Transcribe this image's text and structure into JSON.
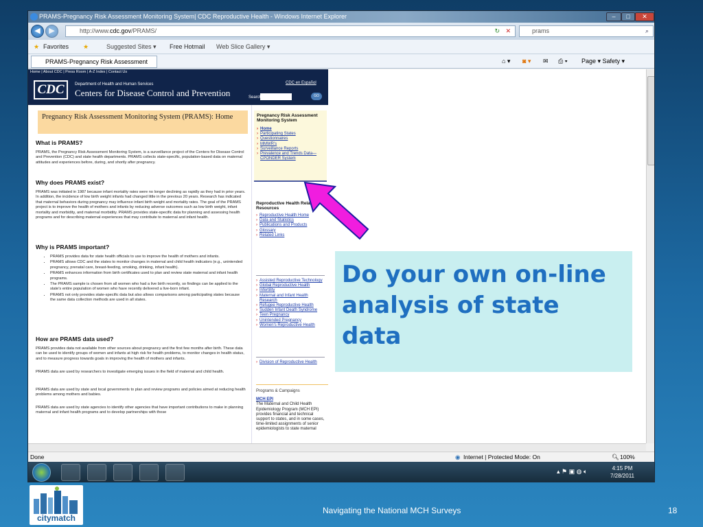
{
  "window": {
    "title": "PRAMS-Pregnancy Risk Assessment Monitoring System| CDC Reproductive Health - Windows Internet Explorer",
    "url_prefix": "http://www.",
    "url_domain": "cdc.gov",
    "url_path": "/PRAMS/",
    "search_value": "prams"
  },
  "favorites_bar": {
    "favorites": "Favorites",
    "suggested": "Suggested Sites ▾",
    "hotmail": "Free Hotmail",
    "webslice": "Web Slice Gallery ▾"
  },
  "tab": {
    "label": "PRAMS-Pregnancy Risk Assessment M...",
    "tools": "Page ▾   Safety ▾"
  },
  "cdc": {
    "toplinks": "Home  |  About CDC  |  Press Room  |  A-Z Index  |  Contact Us",
    "logo": "CDC",
    "dept": "Department of Health and Human Services",
    "name": "Centers for Disease Control and Prevention",
    "espanol": "CDC en Español",
    "search_label": "Search:",
    "go": "GO"
  },
  "content": {
    "page_title": "Pregnancy Risk Assessment Monitoring System (PRAMS): Home",
    "h1": "What is PRAMS?",
    "p1": "PRAMS, the Pregnancy Risk Assessment Monitoring System, is a surveillance project of the Centers for Disease Control and Prevention (CDC) and state health departments. PRAMS collects state-specific, population-based data on maternal attitudes and experiences before, during, and shortly after pregnancy.",
    "h2": "Why does PRAMS exist?",
    "p2": "PRAMS was initiated in 1987 because infant mortality rates were no longer declining as rapidly as they had in prior years. In addition, the incidence of low birth weight infants had changed little in the previous 20 years. Research has indicated that maternal behaviors during pregnancy may influence infant birth weight and mortality rates. The goal of the PRAMS project is to improve the health of mothers and infants by reducing adverse outcomes such as low birth weight, infant mortality and morbidity, and maternal morbidity. PRAMS provides state-specific data for planning and assessing health programs and for describing maternal experiences that may contribute to maternal and infant health.",
    "h3": "Why is PRAMS important?",
    "bullets": [
      "PRAMS provides data for state health officials to use to improve the health of mothers and infants.",
      "PRAMS allows CDC and the states to monitor changes in maternal and child health indicators (e.g., unintended pregnancy, prenatal care, breast-feeding, smoking, drinking, infant health).",
      "PRAMS enhances information from birth certificates used to plan and review state maternal and infant health programs.",
      "The PRAMS sample is chosen from all women who had a live birth recently, so findings can be applied to the state's entire population of women who have recently delivered a live-born infant.",
      "PRAMS not only provides state-specific data but also allows comparisons among participating states because the same data collection methods are used in all states."
    ],
    "h4": "How are PRAMS data used?",
    "p4": "PRAMS provides data not available from other sources about pregnancy and the first few months after birth. These data can be used to identify groups of women and infants at high risk for health problems, to monitor changes in health status, and to measure progress towards goals in improving the health of mothers and infants.",
    "p5": "PRAMS data are used by researchers to investigate emerging issues in the field of maternal and child health.",
    "p6": "PRAMS data are used by state and local governments to plan and review programs and policies aimed at reducing health problems among mothers and babies.",
    "p7": "PRAMS data are used by state agencies to identify other agencies that have important contributions to make in planning maternal and infant health programs and to develop partnerships with those"
  },
  "sidebar": {
    "box_title": "Pregnancy Risk Assessment Monitoring System",
    "links": [
      "Home",
      "Participating States",
      "Questionnaires",
      "MMWR's",
      "Surveillance Reports",
      "Prevalence and Trends Data—CPONDER System"
    ],
    "rr_title": "Reproductive Health Related Resources",
    "rr_links": [
      "Reproductive Health Home",
      "Data and Statistics",
      "Publications and Products",
      "Glossary",
      "Related Links"
    ],
    "rr_links2": [
      "Assisted Reproductive Technology",
      "Global Reproductive Health",
      "Infertility",
      "Maternal and Infant Health Research",
      "Refugee Reproductive Health",
      "Sudden Infant Death Syndrome",
      "Teen Pregnancy",
      "Unintended Pregnancy",
      "Women's Reproductive Health"
    ],
    "rr_links3": [
      "Division of Reproductive Health"
    ],
    "programs_title": "Programs & Campaigns",
    "programs_link": "MCH EPI",
    "programs_text": "The Maternal and Child Health Epidemiology Program (MCH EPI) provides financial and technical support to states, and in some cases, time-limited assignments of senior epidemiologists to state maternal"
  },
  "status": {
    "left": "Done",
    "zone": "Internet | Protected Mode: On",
    "zoom": "100%"
  },
  "taskbar": {
    "time": "4:15 PM",
    "date": "7/28/2011"
  },
  "callout": {
    "line1": "Do your own on-line",
    "line2": "analysis of state",
    "line3": "data"
  },
  "slide": {
    "footer": "Navigating the National MCH Surveys",
    "page_number": "18",
    "logo_text": "citymatch"
  }
}
